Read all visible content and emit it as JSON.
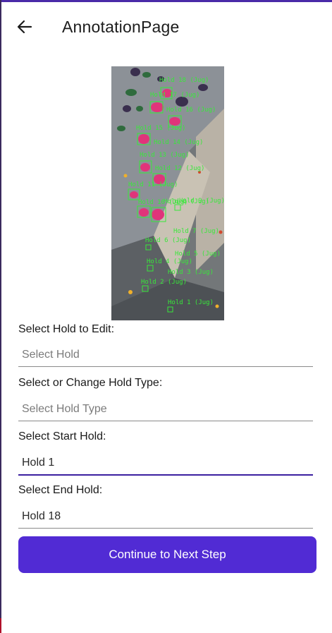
{
  "header": {
    "title": "AnnotationPage",
    "back_icon": "arrow-left-icon"
  },
  "image": {
    "hold_labels": [
      "Hold 18 (Jug)",
      "Hold 17 (Jug)",
      "Hold 16 (Jug)",
      "Hold 15 (Jug)",
      "Hold 14 (Jug)",
      "Hold 13 (Jug)",
      "Hold 12 (Jug)",
      "Hold 11 (Jug)",
      "Hold 10 (Jug)",
      "Hold 9 (Jug)",
      "Hold 8 (Jug)",
      "Hold 7 (Jug)",
      "Hold 6 (Jug)",
      "Hold 5 (Jug)",
      "Hold 4 (Jug)",
      "Hold 3 (Jug)",
      "Hold 2 (Jug)",
      "Hold 1 (Jug)"
    ],
    "label_color": "#38e83a",
    "hold_color": "#e0347a"
  },
  "form": {
    "hold_to_edit_label": "Select Hold to Edit:",
    "hold_to_edit_placeholder": "Select Hold",
    "hold_type_label": "Select or Change Hold Type:",
    "hold_type_placeholder": "Select Hold Type",
    "start_hold_label": "Select Start Hold:",
    "start_hold_value": "Hold 1",
    "end_hold_label": "Select End Hold:",
    "end_hold_value": "Hold 18"
  },
  "continue_button": {
    "label": "Continue to Next Step",
    "color": "#512bd4"
  },
  "accent_color": "#3b1fa0"
}
